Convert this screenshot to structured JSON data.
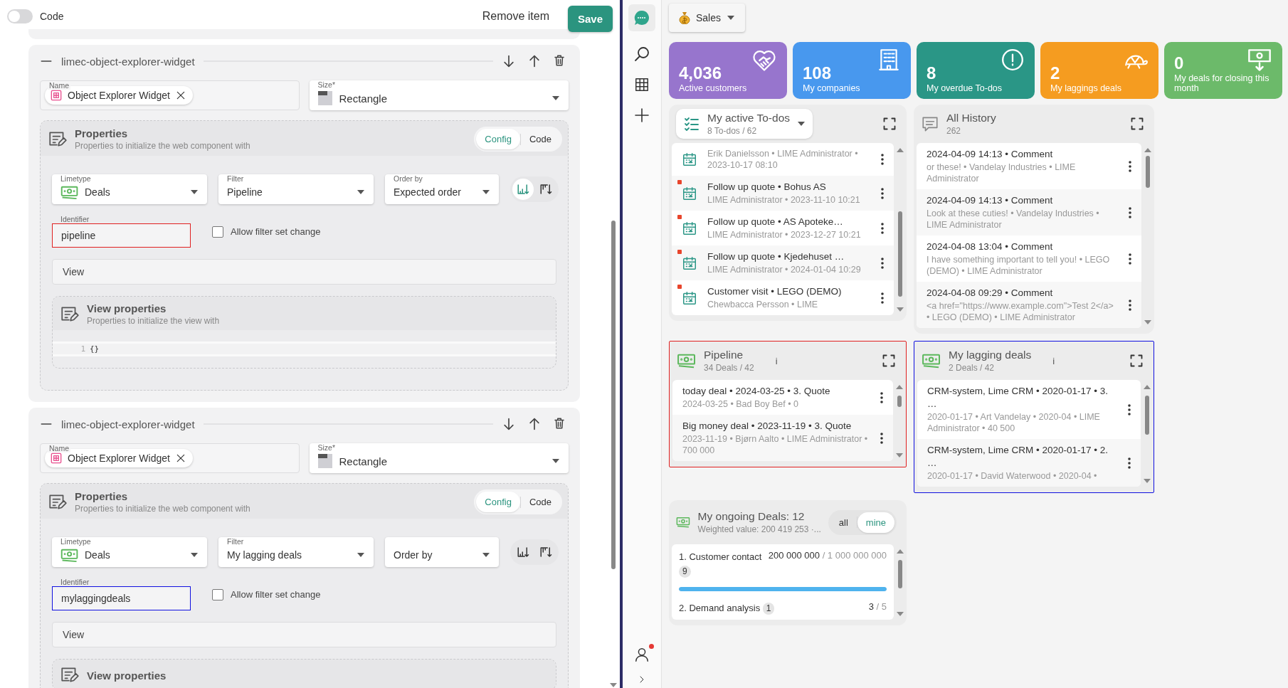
{
  "topbar": {
    "code_toggle": {
      "label": "Code",
      "on": false
    },
    "remove_label": "Remove item",
    "save_label": "Save"
  },
  "widgets": [
    {
      "title": "limec-object-explorer-widget",
      "name": {
        "label": "Name",
        "chip": "Object Explorer Widget"
      },
      "size": {
        "label": "Size*",
        "value": "Rectangle"
      },
      "properties": {
        "title": "Properties",
        "subtitle": "Properties to initialize the web component with",
        "tabs": [
          {
            "label": "Config",
            "selected": true
          },
          {
            "label": "Code",
            "selected": false
          }
        ]
      },
      "limetype": {
        "label": "Limetype",
        "value": "Deals"
      },
      "filter": {
        "label": "Filter",
        "value": "Pipeline"
      },
      "order_by": {
        "label": "Order by",
        "value": "Expected order"
      },
      "sort": [
        {
          "kind": "ascending",
          "selected": true
        },
        {
          "kind": "descending",
          "selected": false
        }
      ],
      "identifier": {
        "label": "Identifier",
        "value": "pipeline",
        "color": "#e02020"
      },
      "allow_filter": {
        "label": "Allow filter set change",
        "checked": false
      },
      "view": {
        "placeholder": "View"
      },
      "view_properties": {
        "title": "View properties",
        "subtitle": "Properties to initialize the view with",
        "code_lines": [
          {
            "number": "1",
            "text": "{}"
          }
        ]
      }
    },
    {
      "title": "limec-object-explorer-widget",
      "name": {
        "label": "Name",
        "chip": "Object Explorer Widget"
      },
      "size": {
        "label": "Size*",
        "value": "Rectangle"
      },
      "properties": {
        "title": "Properties",
        "subtitle": "Properties to initialize the web component with",
        "tabs": [
          {
            "label": "Config",
            "selected": true
          },
          {
            "label": "Code",
            "selected": false
          }
        ]
      },
      "limetype": {
        "label": "Limetype",
        "value": "Deals"
      },
      "filter": {
        "label": "Filter",
        "value": "My lagging deals"
      },
      "order_by": {
        "placeholder": "Order by"
      },
      "sort": [
        {
          "kind": "ascending",
          "selected": false
        },
        {
          "kind": "descending",
          "selected": false
        }
      ],
      "identifier": {
        "label": "Identifier",
        "value": "mylaggingdeals",
        "color": "#1010e0"
      },
      "allow_filter": {
        "label": "Allow filter set change",
        "checked": false
      },
      "view": {
        "placeholder": "View"
      },
      "view_properties": {
        "title": "View properties"
      }
    }
  ],
  "nav": {
    "profile_notification": true
  },
  "dashboard": {
    "label": "Sales"
  },
  "kpis": [
    {
      "kind": "handshake",
      "value": "4,036",
      "label": "Active customers",
      "color": "#9775cd"
    },
    {
      "kind": "building",
      "value": "108",
      "label": "My companies",
      "color": "#4898ee"
    },
    {
      "kind": "alert",
      "value": "8",
      "label": "My overdue To-dos",
      "color": "#2a9686"
    },
    {
      "kind": "turtle",
      "value": "2",
      "label": "My laggings deals",
      "color": "#f59c20"
    },
    {
      "kind": "money",
      "value": "0",
      "label": "My deals for closing this month",
      "color": "#6cba6a"
    }
  ],
  "todos": {
    "title": "My active To-dos",
    "subtitle": "8 To-dos / 62",
    "items": [
      {
        "meta": "Erik Danielsson • LIME Administrator • 2023-10-17 08:10",
        "overdue": false
      },
      {
        "title": "Follow up quote • Bohus AS",
        "meta": "LIME Administrator • 2023-11-10 10:21",
        "overdue": true
      },
      {
        "title": "Follow up quote • AS Apoteke…",
        "meta": "LIME Administrator • 2023-12-27 10:21",
        "overdue": true
      },
      {
        "title": "Follow up quote • Kjedehuset …",
        "meta": "LIME Administrator • 2024-01-04 10:29",
        "overdue": true
      },
      {
        "title": "Customer visit • LEGO (DEMO)",
        "meta": "Chewbacca Persson • LIME",
        "overdue": true
      }
    ]
  },
  "history": {
    "title": "All History",
    "subtitle": "262",
    "items": [
      {
        "title": "2024-04-09 14:13 • Comment",
        "meta": "or these! • Vandelay Industries • LIME Administrator"
      },
      {
        "title": "2024-04-09 14:13 • Comment",
        "meta": "Look at these cuties! • Vandelay Industries • LIME Administrator"
      },
      {
        "title": "2024-04-08 13:04 • Comment",
        "meta": "I have something important to tell you! • LEGO (DEMO) • LIME Administrator"
      },
      {
        "title": "2024-04-08 09:29 • Comment",
        "meta": "<a href=\"https://www.example.com\">Test 2</a> • LEGO (DEMO) • LIME Administrator"
      }
    ]
  },
  "explorers": [
    {
      "title": "Pipeline",
      "subtitle": "34 Deals / 42",
      "info": "i",
      "color": "#e02020",
      "items": [
        {
          "title": "today deal • 2024-03-25 • 3. Quote",
          "meta": "2024-03-25 • Bad Boy Bef • 0"
        },
        {
          "title": "Big money deal • 2023-11-19 • 3. Quote",
          "meta": "2023-11-19 • Bjørn Aalto • LIME Administrator • 700 000"
        }
      ]
    },
    {
      "title": "My lagging deals",
      "subtitle": "2 Deals / 42",
      "info": "i",
      "color": "#1010e0",
      "items": [
        {
          "title": "CRM-system, Lime CRM • 2020-01-17 • 3. …",
          "meta": "2020-01-17 • Art Vandelay • 2020-04 • LIME Administrator • 40 500"
        },
        {
          "title": "CRM-system, Lime CRM • 2020-01-17 • 2. …",
          "meta": "2020-01-17 • David Waterwood • 2020-04 •"
        }
      ]
    }
  ],
  "ongoing": {
    "title": "My ongoing Deals: 12",
    "subtitle": "Weighted value: 200 419 253 ·...",
    "tabs": [
      {
        "label": "all",
        "selected": false
      },
      {
        "label": "mine",
        "selected": true
      }
    ],
    "stages": [
      {
        "name": "1. Customer contact",
        "count": "9",
        "value": "200 000 000",
        "total": "/ 1 000 000 000",
        "level": 1
      },
      {
        "name": "2. Demand analysis",
        "count": "1",
        "value": "3",
        "total": "/ 5"
      }
    ]
  }
}
